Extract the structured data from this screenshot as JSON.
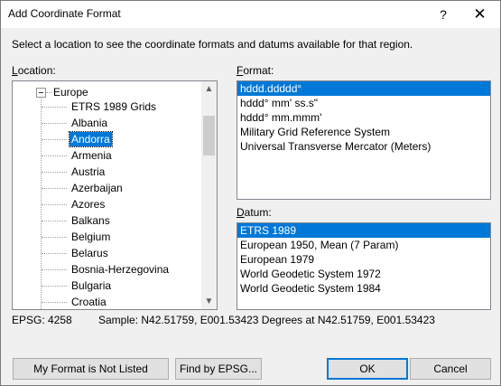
{
  "window": {
    "title": "Add Coordinate Format",
    "help_glyph": "?",
    "close_glyph": "✕"
  },
  "instruction": "Select a location to see the coordinate formats and datums available for that region.",
  "location": {
    "label_mnemonic": "L",
    "label_rest": "ocation:",
    "root": "Europe",
    "items": [
      {
        "label": "ETRS 1989 Grids",
        "selected": false
      },
      {
        "label": "Albania",
        "selected": false
      },
      {
        "label": "Andorra",
        "selected": true
      },
      {
        "label": "Armenia",
        "selected": false
      },
      {
        "label": "Austria",
        "selected": false
      },
      {
        "label": "Azerbaijan",
        "selected": false
      },
      {
        "label": "Azores",
        "selected": false
      },
      {
        "label": "Balkans",
        "selected": false
      },
      {
        "label": "Belgium",
        "selected": false
      },
      {
        "label": "Belarus",
        "selected": false
      },
      {
        "label": "Bosnia-Herzegovina",
        "selected": false
      },
      {
        "label": "Bulgaria",
        "selected": false
      },
      {
        "label": "Croatia",
        "selected": false
      }
    ]
  },
  "format": {
    "label_mnemonic": "F",
    "label_rest": "ormat:",
    "items": [
      {
        "label": "hddd.ddddd°",
        "selected": true
      },
      {
        "label": "hddd° mm' ss.s\"",
        "selected": false
      },
      {
        "label": "hddd° mm.mmm'",
        "selected": false
      },
      {
        "label": "Military Grid Reference System",
        "selected": false
      },
      {
        "label": "Universal Transverse Mercator (Meters)",
        "selected": false
      }
    ]
  },
  "datum": {
    "label_mnemonic": "D",
    "label_rest": "atum:",
    "items": [
      {
        "label": "ETRS 1989",
        "selected": true
      },
      {
        "label": "European 1950, Mean (7 Param)",
        "selected": false
      },
      {
        "label": "European 1979",
        "selected": false
      },
      {
        "label": "World Geodetic System 1972",
        "selected": false
      },
      {
        "label": "World Geodetic System 1984",
        "selected": false
      }
    ]
  },
  "status": {
    "epsg": "EPSG: 4258",
    "sample": "Sample: N42.51759, E001.53423 Degrees at N42.51759, E001.53423"
  },
  "buttons": {
    "not_listed": "My Format is Not Listed",
    "find_epsg": "Find by EPSG...",
    "ok": "OK",
    "cancel": "Cancel"
  },
  "colors": {
    "selection": "#0078d7",
    "dialog_bg": "#f0f0f0"
  }
}
